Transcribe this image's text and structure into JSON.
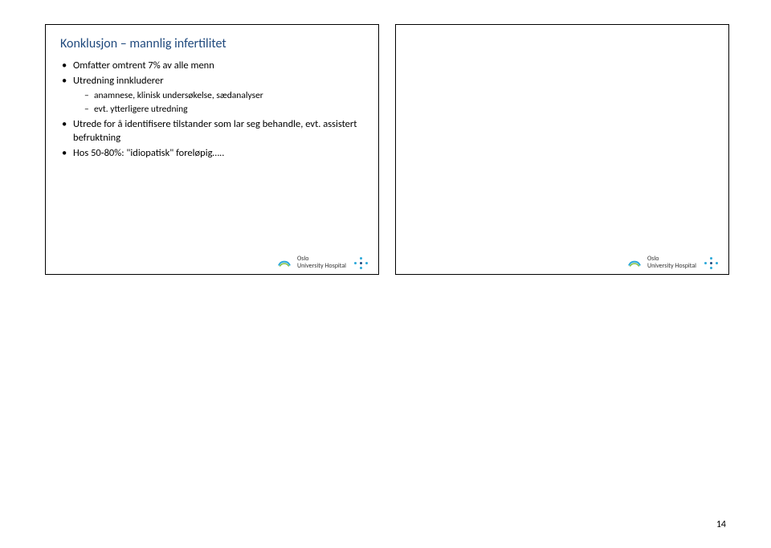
{
  "page_number": "14",
  "slide_left": {
    "title": "Konklusjon – mannlig infertilitet",
    "bullets": [
      {
        "text": "Omfatter omtrent 7% av alle menn",
        "sub": []
      },
      {
        "text": "Utredning innkluderer",
        "sub": [
          "anamnese, klinisk undersøkelse, sædanalyser",
          "evt. ytterligere utredning"
        ]
      },
      {
        "text": "Utrede for å identifisere tilstander som lar seg behandle, evt. assistert befruktning",
        "sub": []
      },
      {
        "text": "Hos 50-80%: \"idiopatisk\" foreløpig…..",
        "sub": []
      }
    ]
  },
  "footer": {
    "brand_line1": "Oslo",
    "brand_line2": "University Hospital"
  }
}
